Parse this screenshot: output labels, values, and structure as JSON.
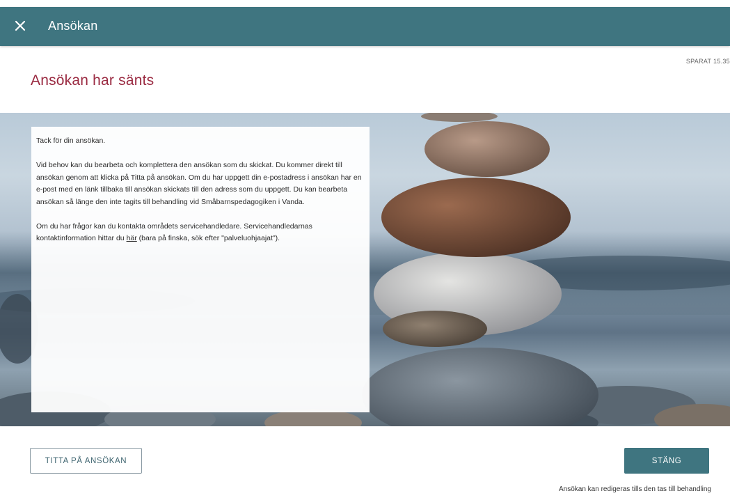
{
  "header": {
    "close_icon": "close-icon",
    "title": "Ansökan"
  },
  "saved_status": "SPARAT 15.35",
  "page_title": "Ansökan har sänts",
  "card": {
    "p1": "Tack för din ansökan.",
    "p2": "Vid behov kan du bearbeta och komplettera den ansökan som du skickat. Du kommer direkt till ansökan genom att klicka på Titta på ansökan. Om du har uppgett din e-postadress i ansökan har en e-post med en länk tillbaka till ansökan skickats till den adress som du uppgett. Du kan bearbeta ansökan så länge den inte tagits till behandling vid Småbarnspedagogiken i Vanda.",
    "p3_before": "Om du har frågor kan du kontakta områdets servicehandledare. Servicehandledarnas kontaktinformation hittar du ",
    "p3_link": "här",
    "p3_after": " (bara på finska, sök efter \"palveluohjaajat\")."
  },
  "buttons": {
    "view_application": "TITTA PÅ ANSÖKAN",
    "close": "STÄNG"
  },
  "footnote": "Ansökan kan redigeras tills den tas till behandling",
  "colors": {
    "header_bg": "#3f7580",
    "heading": "#9a2a41",
    "primary_button": "#3f7580"
  }
}
